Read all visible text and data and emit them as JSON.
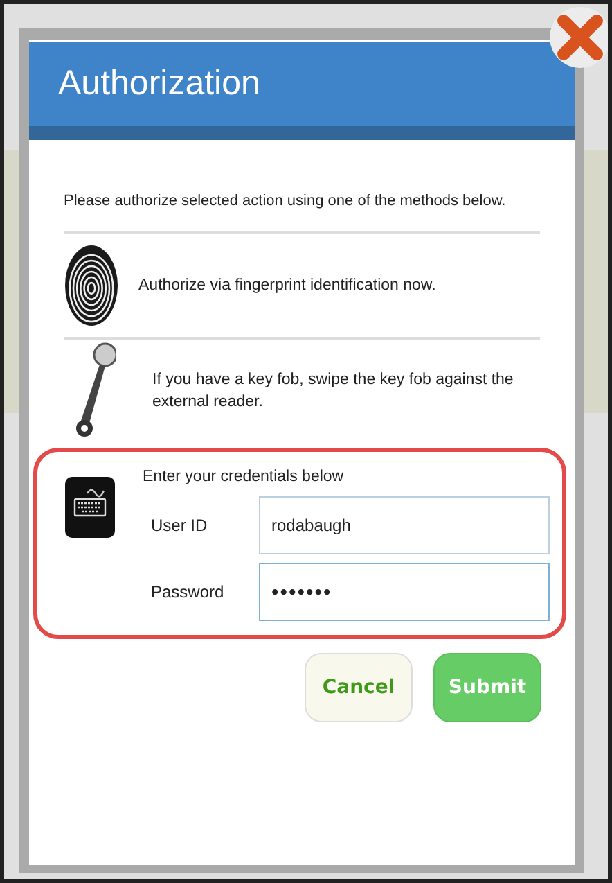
{
  "dialog": {
    "title": "Authorization",
    "intro": "Please authorize selected action using one of the methods below.",
    "methods": [
      {
        "kind": "fingerprint",
        "text": "Authorize via fingerprint identification now."
      },
      {
        "kind": "keyfob",
        "text": "If you have a key fob, swipe the key fob against the external reader."
      }
    ],
    "credentials": {
      "heading": "Enter your credentials below",
      "highlighted": true,
      "fields": [
        {
          "label": "User ID",
          "value": "rodabaugh",
          "kind": "text"
        },
        {
          "label": "Password",
          "value": "•••••••",
          "kind": "password"
        }
      ]
    },
    "buttons": [
      {
        "label": "Cancel",
        "kind": "secondary"
      },
      {
        "label": "Submit",
        "kind": "primary"
      }
    ]
  }
}
